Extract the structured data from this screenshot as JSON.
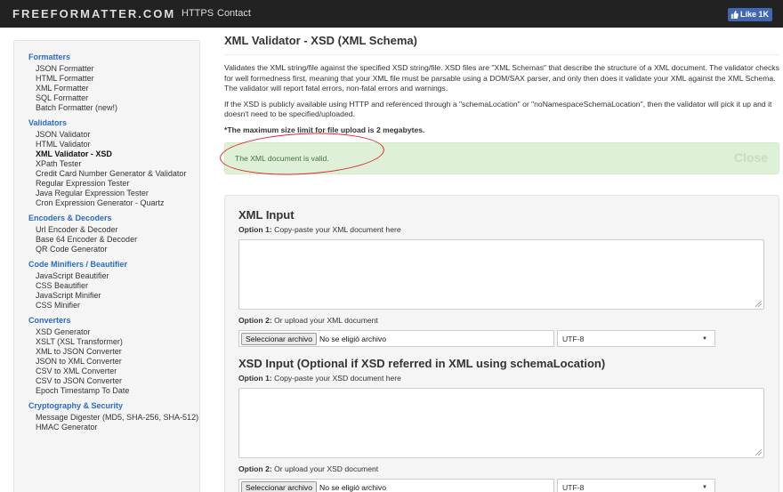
{
  "nav": {
    "brand": "FREEFORMATTER.COM",
    "links": [
      "HTTPS",
      "Contact"
    ],
    "like_label": "Like 1K"
  },
  "sidebar": {
    "groups": [
      {
        "heading": "Formatters",
        "items": [
          "JSON Formatter",
          "HTML Formatter",
          "XML Formatter",
          "SQL Formatter",
          "Batch Formatter (new!)"
        ]
      },
      {
        "heading": "Validators",
        "items": [
          "JSON Validator",
          "HTML Validator",
          "XML Validator - XSD",
          "XPath Tester",
          "Credit Card Number Generator & Validator",
          "Regular Expression Tester",
          "Java Regular Expression Tester",
          "Cron Expression Generator - Quartz"
        ]
      },
      {
        "heading": "Encoders & Decoders",
        "items": [
          "Url Encoder & Decoder",
          "Base 64 Encoder & Decoder",
          "QR Code Generator"
        ]
      },
      {
        "heading": "Code Minifiers / Beautifier",
        "items": [
          "JavaScript Beautifier",
          "CSS Beautifier",
          "JavaScript Minifier",
          "CSS Minifier"
        ]
      },
      {
        "heading": "Converters",
        "items": [
          "XSD Generator",
          "XSLT (XSL Transformer)",
          "XML to JSON Converter",
          "JSON to XML Converter",
          "CSV to XML Converter",
          "CSV to JSON Converter",
          "Epoch Timestamp To Date"
        ]
      },
      {
        "heading": "Cryptography & Security",
        "items": [
          "Message Digester (MD5, SHA-256, SHA-512)",
          "HMAC Generator"
        ]
      }
    ],
    "active_item": "XML Validator - XSD"
  },
  "main": {
    "title": "XML Validator - XSD (XML Schema)",
    "para1": "Validates the XML string/file against the specified XSD string/file. XSD files are \"XML Schemas\" that describe the structure of a XML document. The validator checks for well formedness first, meaning that your XML file must be parsable using a DOM/SAX parser, and only then does it validate your XML against the XML Schema. The validator will report fatal errors, non-fatal errors and warnings.",
    "para2": "If the XSD is publicly available using HTTP and referenced through a \"schemaLocation\" or \"noNamespaceSchemaLocation\", then the validator will pick it up and it doesn't need to be specified/uploaded.",
    "limit_note": "*The maximum size limit for file upload is 2 megabytes.",
    "alert_text": "The XML document is valid.",
    "alert_close": "Close"
  },
  "xml_input": {
    "title": "XML Input",
    "opt1_prefix": "Option 1:",
    "opt1_text": "Copy-paste your XML document here",
    "opt2_prefix": "Option 2:",
    "opt2_text": "Or upload your XML document",
    "file_button": "Seleccionar archivo",
    "file_status": "No se eligió archivo",
    "encoding": "UTF-8"
  },
  "xsd_input": {
    "title": "XSD Input (Optional if XSD referred in XML using schemaLocation)",
    "opt1_prefix": "Option 1:",
    "opt1_text": "Copy-paste your XSD document here",
    "opt2_prefix": "Option 2:",
    "opt2_text": "Or upload your XSD document",
    "file_button": "Seleccionar archivo",
    "file_status": "No se eligió archivo",
    "encoding": "UTF-8"
  },
  "colors": {
    "navbar": "#222222",
    "sidebar_heading": "#2a6ac8",
    "alert_bg": "#dff0d8",
    "annotation": "#e2262a"
  }
}
